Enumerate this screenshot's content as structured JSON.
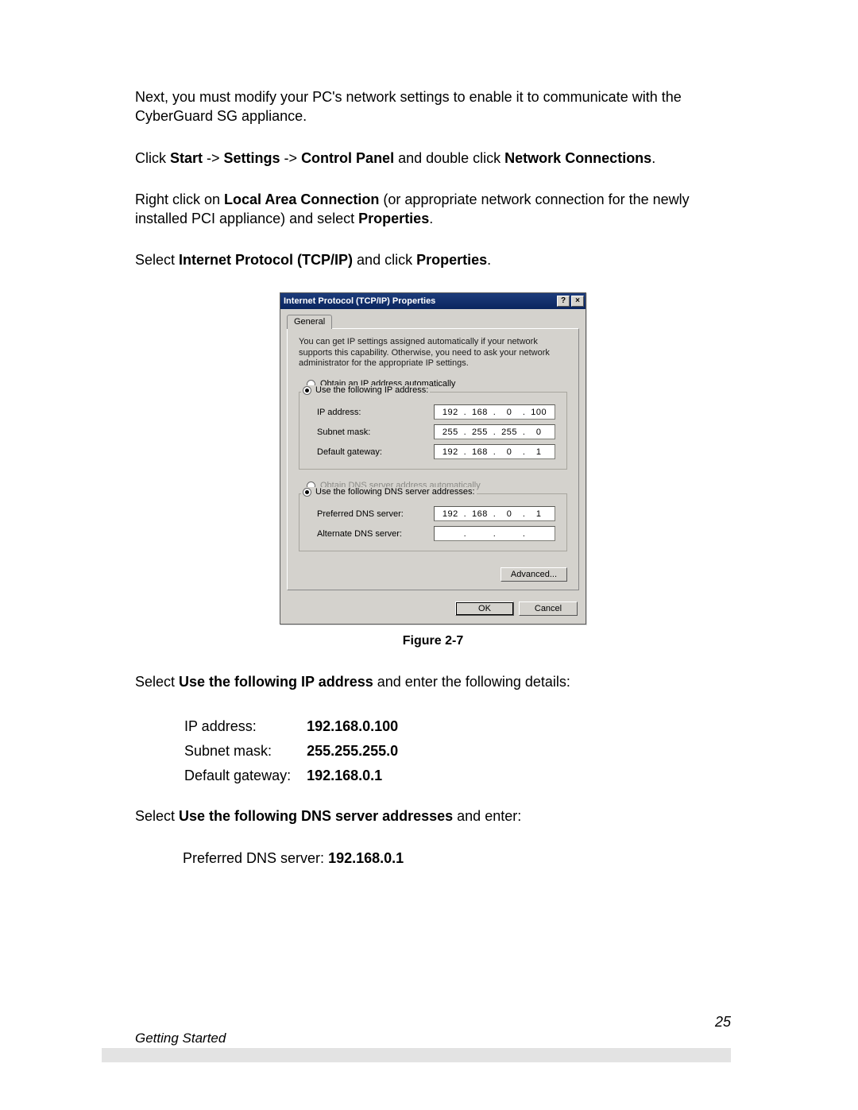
{
  "para1": "Next, you must modify your PC's network settings to enable it to communicate with the CyberGuard SG appliance.",
  "p2": {
    "a": "Click ",
    "b": "Start",
    "c": " -> ",
    "d": "Settings",
    "e": " -> ",
    "f": "Control Panel",
    "g": " and double click ",
    "h": "Network Connections",
    "i": "."
  },
  "p3": {
    "a": "Right click on ",
    "b": "Local Area Connection",
    "c": " (or appropriate network connection for the newly installed PCI appliance) and select ",
    "d": "Properties",
    "e": "."
  },
  "p4": {
    "a": "Select ",
    "b": "Internet Protocol (TCP/IP)",
    "c": " and click ",
    "d": "Properties",
    "e": "."
  },
  "dialog": {
    "title": "Internet Protocol (TCP/IP) Properties",
    "help_btn": "?",
    "close_btn": "×",
    "tab": "General",
    "info": "You can get IP settings assigned automatically if your network supports this capability. Otherwise, you need to ask your network administrator for the appropriate IP settings.",
    "radio": {
      "auto_ip": "Obtain an IP address automatically",
      "use_ip": "Use the following IP address:",
      "auto_dns": "Obtain DNS server address automatically",
      "use_dns": "Use the following DNS server addresses:"
    },
    "fields": {
      "ip_label": "IP address:",
      "ip": [
        "192",
        "168",
        "0",
        "100"
      ],
      "mask_label": "Subnet mask:",
      "mask": [
        "255",
        "255",
        "255",
        "0"
      ],
      "gw_label": "Default gateway:",
      "gw": [
        "192",
        "168",
        "0",
        "1"
      ],
      "pdns_label": "Preferred DNS server:",
      "pdns": [
        "192",
        "168",
        "0",
        "1"
      ],
      "adns_label": "Alternate DNS server:",
      "adns": [
        "",
        "",
        "",
        ""
      ]
    },
    "buttons": {
      "advanced": "Advanced...",
      "ok": "OK",
      "cancel": "Cancel"
    }
  },
  "figure_caption": "Figure 2-7",
  "p5": {
    "a": "Select ",
    "b": "Use the following IP address",
    "c": " and enter the following details:"
  },
  "details": {
    "r1l": "IP address:",
    "r1v": "192.168.0.100",
    "r2l": "Subnet mask:",
    "r2v": "255.255.255.0",
    "r3l": "Default gateway:",
    "r3v": "192.168.0.1"
  },
  "p6": {
    "a": "Select ",
    "b": "Use the following DNS server addresses",
    "c": " and enter:"
  },
  "p7": {
    "a": "Preferred DNS server: ",
    "b": "192.168.0.1"
  },
  "footer": "Getting Started",
  "page_num": "25"
}
